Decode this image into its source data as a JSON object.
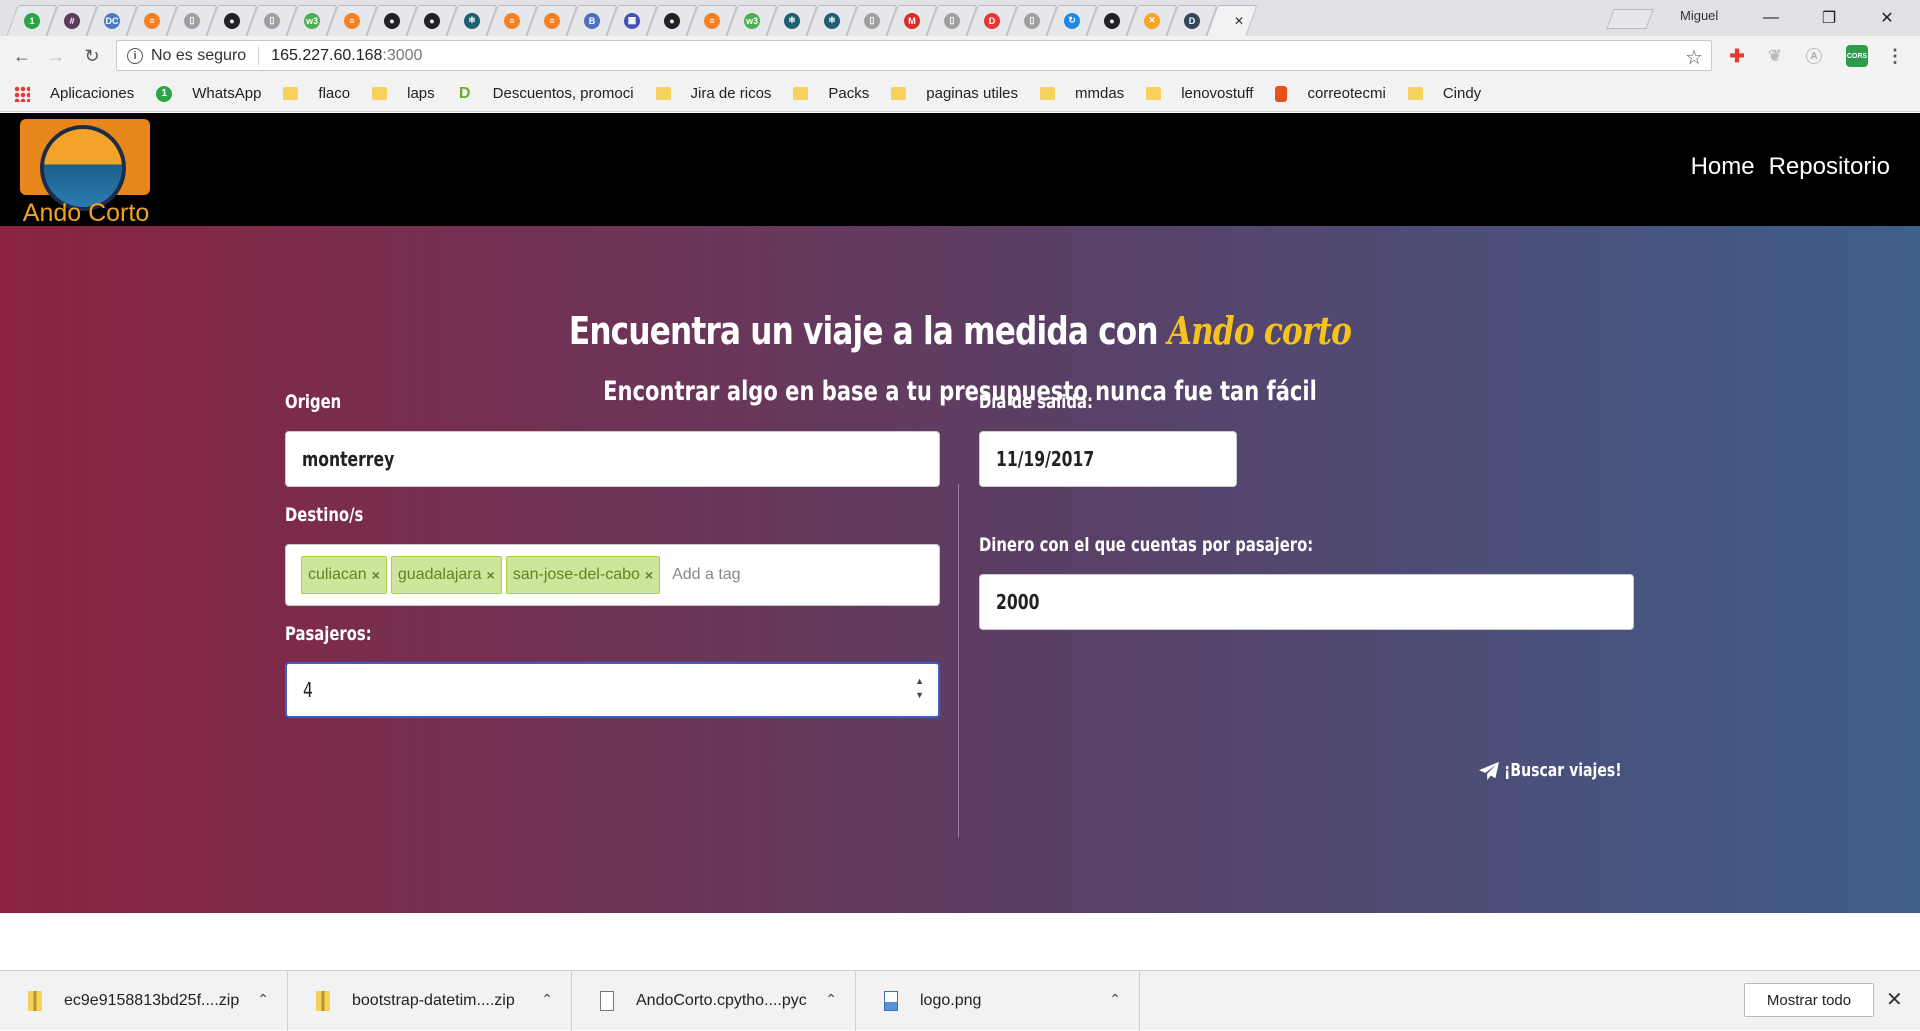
{
  "browser": {
    "tabs": [
      {
        "icon": "whatsapp-icon",
        "color": "#2aa644",
        "glyph": "1"
      },
      {
        "icon": "slack-icon",
        "color": "#5b3a5c",
        "glyph": "#"
      },
      {
        "icon": "dc-icon",
        "color": "#4d7cc0",
        "glyph": "DC"
      },
      {
        "icon": "stackoverflow-icon",
        "color": "#f48024",
        "glyph": "≡"
      },
      {
        "icon": "document-icon",
        "color": "#9e9e9e",
        "glyph": "▯"
      },
      {
        "icon": "github-icon",
        "color": "#222222",
        "glyph": "●"
      },
      {
        "icon": "document-icon",
        "color": "#9e9e9e",
        "glyph": "▯"
      },
      {
        "icon": "w3schools-icon",
        "color": "#4caf50",
        "glyph": "w3"
      },
      {
        "icon": "stackoverflow-icon",
        "color": "#f48024",
        "glyph": "≡"
      },
      {
        "icon": "github-icon",
        "color": "#222222",
        "glyph": "●"
      },
      {
        "icon": "github-icon",
        "color": "#222222",
        "glyph": "●"
      },
      {
        "icon": "react-icon",
        "color": "#1f5f6f",
        "glyph": "⚛"
      },
      {
        "icon": "stackoverflow-icon",
        "color": "#f48024",
        "glyph": "≡"
      },
      {
        "icon": "stackoverflow-icon",
        "color": "#f48024",
        "glyph": "≡"
      },
      {
        "icon": "bootstrap-icon",
        "color": "#4f6fbf",
        "glyph": "B"
      },
      {
        "icon": "devtools-icon",
        "color": "#3f51b5",
        "glyph": "▦"
      },
      {
        "icon": "github-icon",
        "color": "#222222",
        "glyph": "●"
      },
      {
        "icon": "stackoverflow-icon",
        "color": "#f48024",
        "glyph": "≡"
      },
      {
        "icon": "w3schools-icon",
        "color": "#4caf50",
        "glyph": "w3"
      },
      {
        "icon": "react-icon",
        "color": "#1f5f6f",
        "glyph": "⚛"
      },
      {
        "icon": "react-icon",
        "color": "#1f5f6f",
        "glyph": "⚛"
      },
      {
        "icon": "document-icon",
        "color": "#9e9e9e",
        "glyph": "▯"
      },
      {
        "icon": "gmail-icon",
        "color": "#d93025",
        "glyph": "M"
      },
      {
        "icon": "document-icon",
        "color": "#9e9e9e",
        "glyph": "▯"
      },
      {
        "icon": "d-red-icon",
        "color": "#e53935",
        "glyph": "D"
      },
      {
        "icon": "document-icon",
        "color": "#9e9e9e",
        "glyph": "▯"
      },
      {
        "icon": "loading-icon",
        "color": "#1e88e5",
        "glyph": "↻"
      },
      {
        "icon": "github-icon",
        "color": "#222222",
        "glyph": "●"
      },
      {
        "icon": "x-orange-icon",
        "color": "#f5a623",
        "glyph": "✕"
      },
      {
        "icon": "d-dark-icon",
        "color": "#33475b",
        "glyph": "D"
      },
      {
        "icon": "active-tab",
        "color": "#f2f2f2",
        "glyph": ""
      }
    ],
    "profile_name": "Miguel",
    "address": {
      "security_text": "No es seguro",
      "host": "165.227.60.168",
      "port": ":3000"
    },
    "bookmarks": [
      {
        "label": "Aplicaciones",
        "icon": "apps-grid-icon"
      },
      {
        "label": "WhatsApp",
        "icon": "whatsapp-icon"
      },
      {
        "label": "flaco",
        "icon": "folder-icon"
      },
      {
        "label": "laps",
        "icon": "folder-icon"
      },
      {
        "label": "Descuentos, promoci",
        "icon": "descuentos-icon"
      },
      {
        "label": "Jira de ricos",
        "icon": "folder-icon"
      },
      {
        "label": "Packs",
        "icon": "folder-icon"
      },
      {
        "label": "paginas utiles",
        "icon": "folder-icon"
      },
      {
        "label": "mmdas",
        "icon": "folder-icon"
      },
      {
        "label": "lenovostuff",
        "icon": "folder-icon"
      },
      {
        "label": "correotecmi",
        "icon": "office-icon"
      },
      {
        "label": "Cindy",
        "icon": "folder-icon"
      }
    ]
  },
  "site": {
    "logo_text": "Ando Corto",
    "nav": {
      "home": "Home",
      "repo": "Repositorio"
    },
    "hero": {
      "title_prefix": "Encuentra un viaje a la medida con ",
      "title_brand": "Ando corto",
      "subtitle": "Encontrar algo en base a tu presupuesto nunca fue tan fácil"
    },
    "form": {
      "origin_label": "Origen",
      "origin_value": "monterrey",
      "dest_label": "Destino/s",
      "dest_tags": [
        "culiacan",
        "guadalajara",
        "san-jose-del-cabo"
      ],
      "dest_placeholder": "Add a tag",
      "passengers_label": "Pasajeros:",
      "passengers_value": "4",
      "date_label": "Día de salida:",
      "date_value": "11/19/2017",
      "money_label": "Dinero con el que cuentas por pasajero:",
      "money_value": "2000",
      "search_label": "¡Buscar viajes!"
    }
  },
  "downloads": {
    "items": [
      {
        "name": "ec9e9158813bd25f....zip",
        "icon": "zip-icon"
      },
      {
        "name": "bootstrap-datetim....zip",
        "icon": "zip-icon"
      },
      {
        "name": "AndoCorto.cpytho....pyc",
        "icon": "file-icon"
      },
      {
        "name": "logo.png",
        "icon": "image-file-icon"
      }
    ],
    "show_all": "Mostrar todo"
  }
}
